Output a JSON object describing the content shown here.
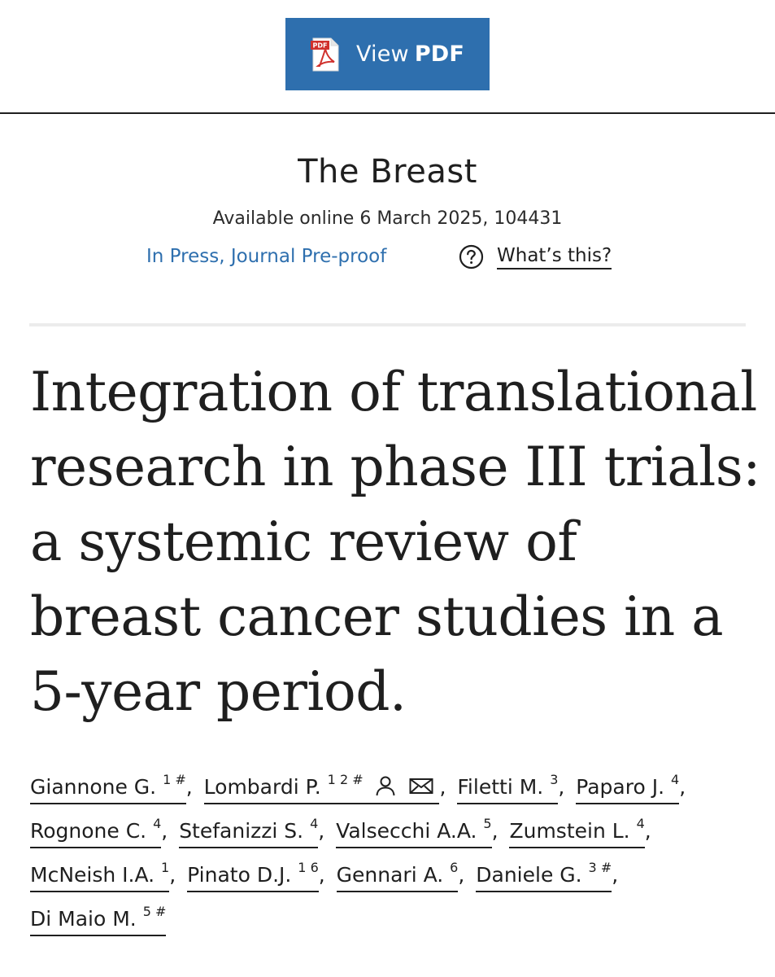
{
  "toolbar": {
    "pdf_label": "View",
    "pdf_label_strong": "PDF",
    "pdf_icon": "pdf-file-icon"
  },
  "journal": {
    "name": "The Breast",
    "availability": "Available online 6 March 2025, 104431",
    "status": "In Press, Journal Pre-proof",
    "help_label": "What’s this?",
    "help_icon": "question-circle-icon"
  },
  "article": {
    "title": "Integration of translational research in phase III trials: a systemic review of breast cancer studies in a 5-year period."
  },
  "authors": [
    {
      "name": "Giannone G.",
      "sup": "1 #"
    },
    {
      "name": "Lombardi P.",
      "sup": "1 2 #",
      "icons": [
        "person-icon",
        "envelope-icon"
      ]
    },
    {
      "name": "Filetti M.",
      "sup": "3"
    },
    {
      "name": "Paparo J.",
      "sup": "4"
    },
    {
      "name": "Rognone C.",
      "sup": "4"
    },
    {
      "name": "Stefanizzi S.",
      "sup": "4"
    },
    {
      "name": "Valsecchi A.A.",
      "sup": "5"
    },
    {
      "name": "Zumstein L.",
      "sup": "4"
    },
    {
      "name": "McNeish I.A.",
      "sup": "1"
    },
    {
      "name": "Pinato D.J.",
      "sup": "1 6"
    },
    {
      "name": "Gennari A.",
      "sup": "6"
    },
    {
      "name": "Daniele G.",
      "sup": "3 #"
    },
    {
      "name": "Di Maio M.",
      "sup": "5 #"
    }
  ],
  "colors": {
    "accent": "#2e6fae",
    "text": "#1f1f1f"
  }
}
